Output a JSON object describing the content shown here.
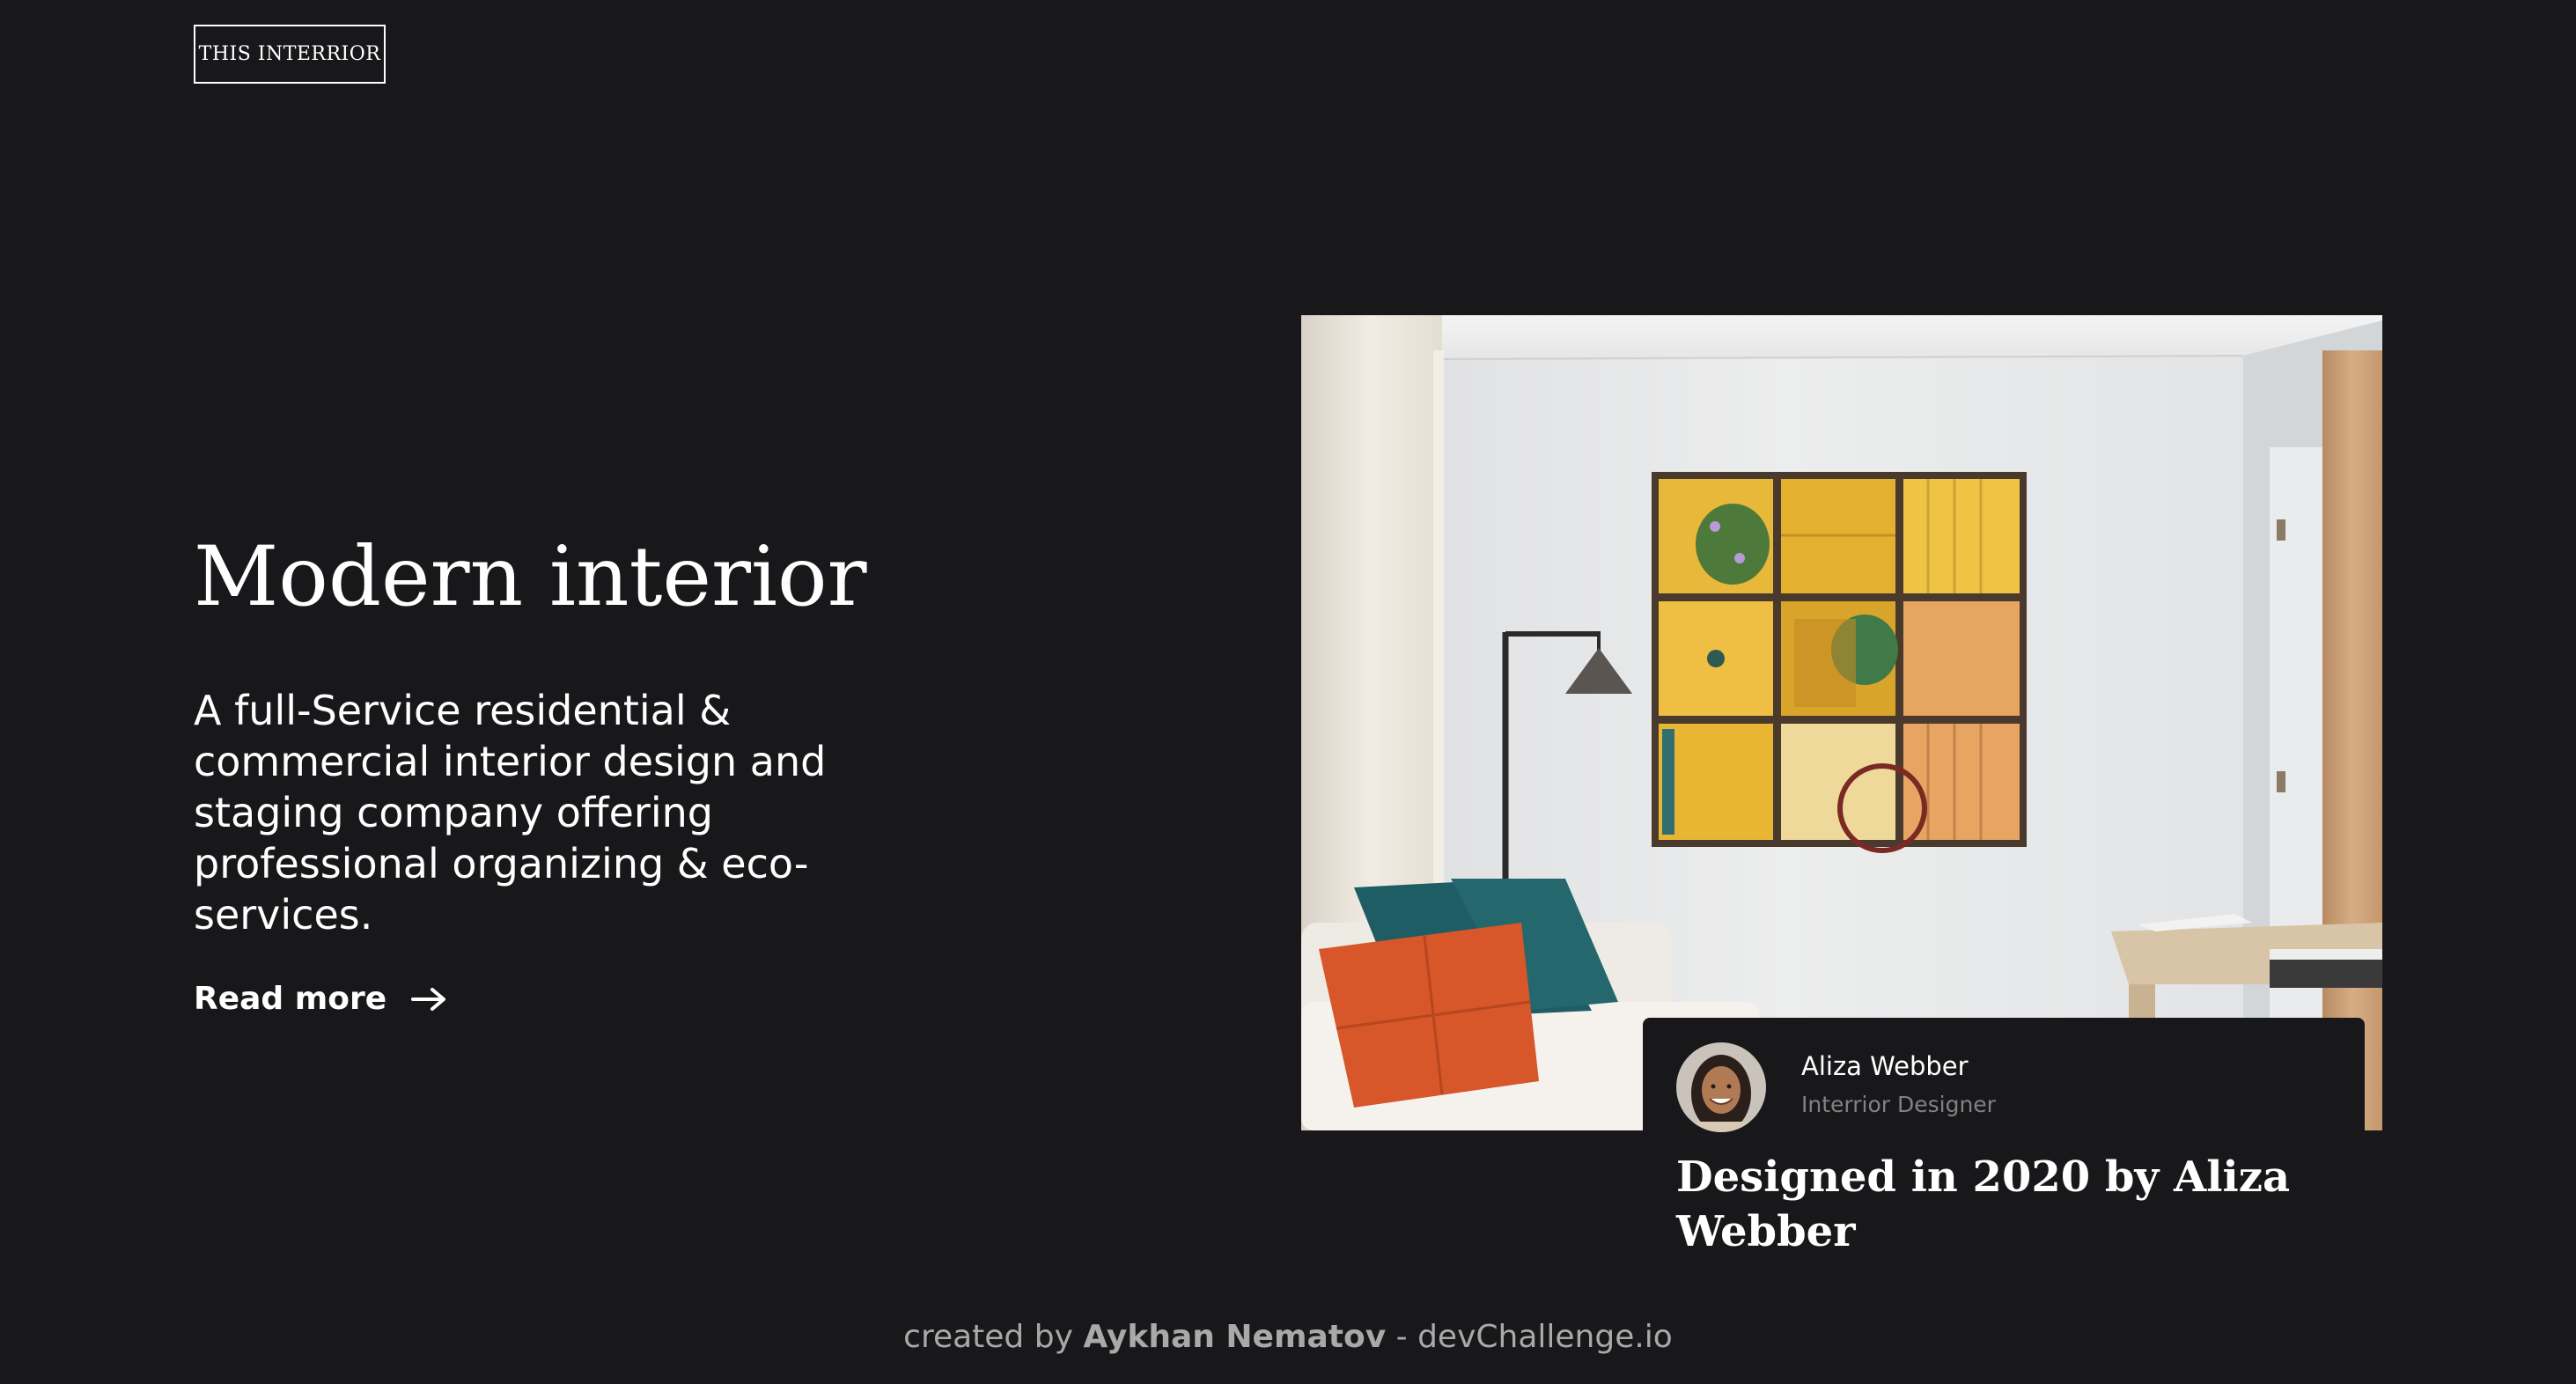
{
  "header": {
    "logo_text": "THIS INTERRIOR"
  },
  "hero": {
    "title": "Modern interior",
    "description": "A full-Service residential & commercial interior design and staging company offering professional organizing & eco-services.",
    "read_more_label": "Read more",
    "read_more_icon": "arrow-right-icon"
  },
  "featured": {
    "image_icon": "interior-room-photo",
    "designer_name": "Aliza Webber",
    "designer_role": "Interrior Designer",
    "caption": "Designed in 2020 by Aliza Webber"
  },
  "footer": {
    "prefix": "created by",
    "author": "Aykhan Nematov",
    "separator": "-",
    "site": "devChallenge.io"
  },
  "colors": {
    "background": "#18171a",
    "text": "#ffffff",
    "muted": "#828282",
    "footer": "#a9a9a9"
  }
}
